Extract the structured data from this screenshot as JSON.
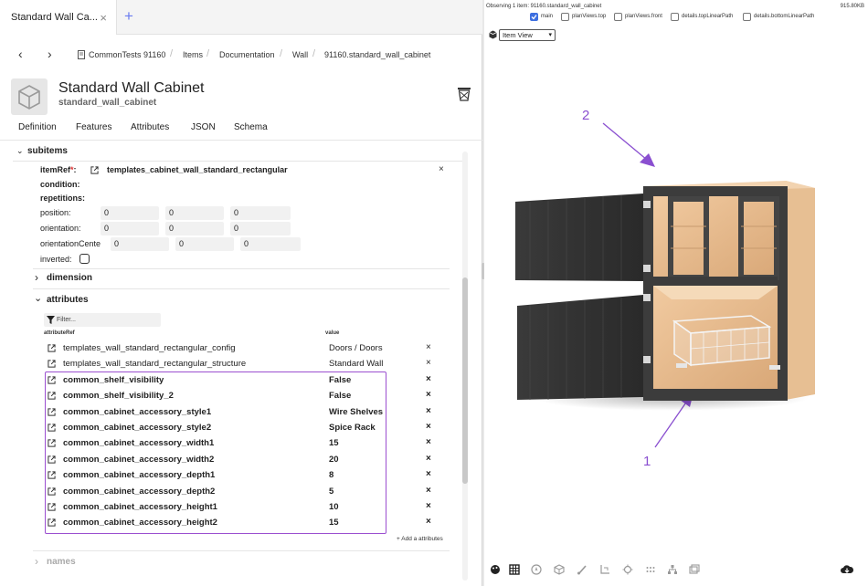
{
  "tabbar": {
    "tab_title": "Standard Wall Ca...",
    "close": "×",
    "new_tab": "+"
  },
  "breadcrumbs": [
    "CommonTests 91160",
    "Items",
    "Documentation",
    "Wall",
    "91160.standard_wall_cabinet"
  ],
  "header": {
    "title": "Standard Wall Cabinet",
    "subtitle": "standard_wall_cabinet"
  },
  "tabs": [
    "Definition",
    "Features",
    "Attributes",
    "JSON",
    "Schema"
  ],
  "subitems": {
    "label": "subitems",
    "itemref_label": "itemRef",
    "required_mark": "*",
    "itemref_value": "templates_cabinet_wall_standard_rectangular",
    "condition_label": "condition:",
    "repetitions_label": "repetitions:",
    "position_label": "position:",
    "position": [
      "0",
      "0",
      "0"
    ],
    "orientation_label": "orientation:",
    "orientation": [
      "0",
      "0",
      "0"
    ],
    "orientation_center_label": "orientationCente",
    "orientation_center": [
      "0",
      "0",
      "0"
    ],
    "inverted_label": "inverted:"
  },
  "dimension_label": "dimension",
  "attributes": {
    "label": "attributes",
    "filter_placeholder": "Filter...",
    "col_ref": "attributeRef",
    "col_value": "value",
    "rows": [
      {
        "name": "templates_wall_standard_rectangular_config",
        "value": "Doors / Doors",
        "bold": false
      },
      {
        "name": "templates_wall_standard_rectangular_structure",
        "value": "Standard Wall",
        "bold": false
      },
      {
        "name": "common_shelf_visibility",
        "value": "False",
        "bold": true
      },
      {
        "name": "common_shelf_visibility_2",
        "value": "False",
        "bold": true
      },
      {
        "name": "common_cabinet_accessory_style1",
        "value": "Wire Shelves",
        "bold": true
      },
      {
        "name": "common_cabinet_accessory_style2",
        "value": "Spice Rack",
        "bold": true
      },
      {
        "name": "common_cabinet_accessory_width1",
        "value": "15",
        "bold": true
      },
      {
        "name": "common_cabinet_accessory_width2",
        "value": "20",
        "bold": true
      },
      {
        "name": "common_cabinet_accessory_depth1",
        "value": "8",
        "bold": true
      },
      {
        "name": "common_cabinet_accessory_depth2",
        "value": "5",
        "bold": true
      },
      {
        "name": "common_cabinet_accessory_height1",
        "value": "10",
        "bold": true
      },
      {
        "name": "common_cabinet_accessory_height2",
        "value": "15",
        "bold": true
      }
    ],
    "remove": "×",
    "add_label": "+ Add a attributes"
  },
  "names_label": "names",
  "viewer": {
    "observing": "Observing 1 item: 91160.standard_wall_cabinet",
    "file_size": "915.80KB",
    "checkboxes": [
      {
        "label": "main",
        "checked": true
      },
      {
        "label": "planViews.top",
        "checked": false
      },
      {
        "label": "planViews.front",
        "checked": false
      },
      {
        "label": "details.topLinearPath",
        "checked": false
      },
      {
        "label": "details.bottomLinearPath",
        "checked": false
      }
    ],
    "view_select": "Item View",
    "annotation_1": "1",
    "annotation_2": "2",
    "accent": "#8a4fd0"
  }
}
